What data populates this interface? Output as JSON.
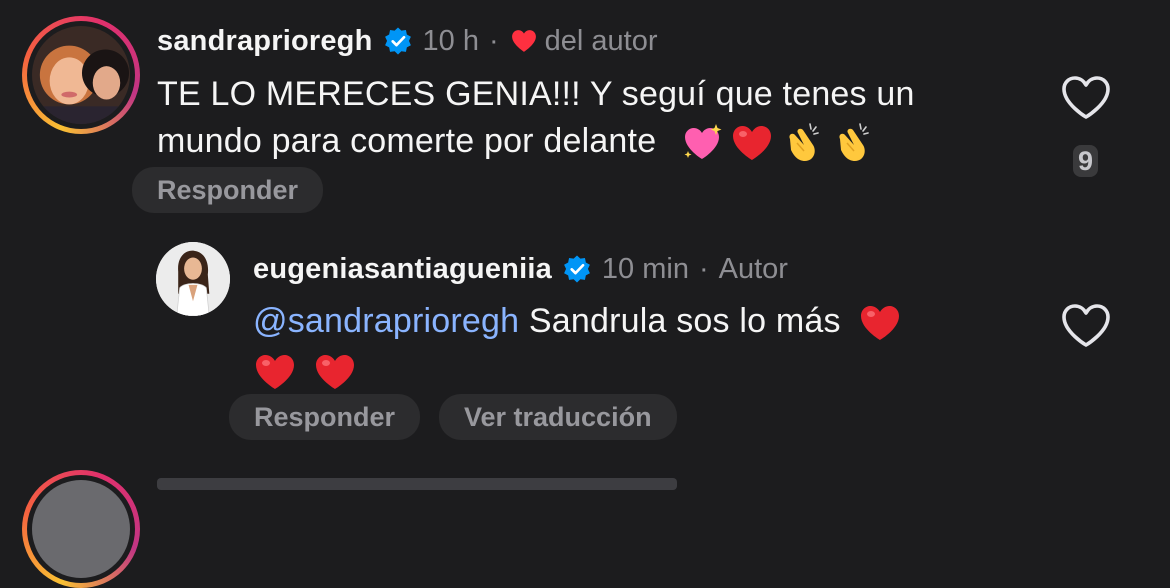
{
  "comments": [
    {
      "username": "sandraprioregh",
      "verified": true,
      "time": "10 h",
      "separator": "·",
      "author_like_label": "del autor",
      "text_line1": "TE LO MERECES GENIA!!! Y seguí que tenes un",
      "text_line2": "mundo para comerte por delante",
      "emojis": [
        "sparkling-heart-emoji",
        "red-heart-emoji",
        "clapping-hands-emoji",
        "clapping-hands-emoji"
      ],
      "reply_label": "Responder",
      "like_count": "9"
    },
    {
      "username": "eugeniasantiagueniia",
      "verified": true,
      "time": "10 min",
      "separator": "·",
      "author_label": "Autor",
      "mention": "@sandraprioregh",
      "text_line1": "Sandrula sos lo más",
      "emojis_line1": [
        "red-heart-emoji"
      ],
      "emojis_line2": [
        "red-heart-emoji",
        "red-heart-emoji"
      ],
      "reply_label": "Responder",
      "translate_label": "Ver traducción"
    }
  ],
  "colors": {
    "background": "#1c1c1e",
    "muted_text": "#8e8e93",
    "mention": "#8ab4ff",
    "verified_blue": "#0095f6",
    "heart_red": "#ff3040",
    "pill_bg": "#2c2c2e"
  }
}
